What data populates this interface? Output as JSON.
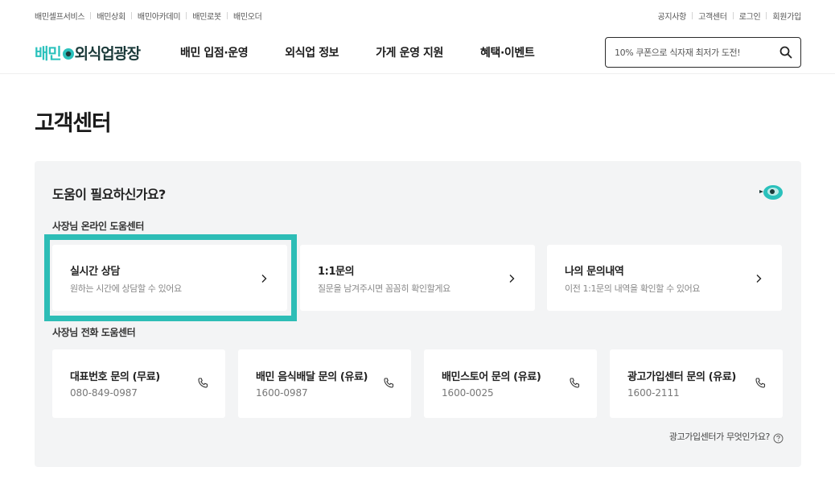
{
  "utility": {
    "left": [
      "배민셀프서비스",
      "배민상회",
      "배민아카데미",
      "배민로봇",
      "배민오더"
    ],
    "right": [
      "공지사항",
      "고객센터",
      "로그인",
      "회원가입"
    ]
  },
  "header": {
    "logo_a": "배민",
    "logo_b": "외식업광장",
    "nav": [
      "배민 입점·운영",
      "외식업 정보",
      "가게 운영 지원",
      "혜택·이벤트"
    ],
    "search_placeholder": "10% 쿠폰으로 식자재 최저가 도전!"
  },
  "page": {
    "title": "고객센터"
  },
  "help": {
    "title": "도움이 필요하신가요?",
    "online_section": "사장님 온라인 도움센터",
    "online_cards": [
      {
        "title": "실시간 상담",
        "desc": "원하는 시간에 상담할 수 있어요"
      },
      {
        "title": "1:1문의",
        "desc": "질문을 남겨주시면 꼼꼼히 확인할게요"
      },
      {
        "title": "나의 문의내역",
        "desc": "이전 1:1문의 내역을 확인할 수 있어요"
      }
    ],
    "phone_section": "사장님 전화 도움센터",
    "phone_cards": [
      {
        "title": "대표번호 문의 (무료)",
        "number": "080-849-0987"
      },
      {
        "title": "배민 음식배달 문의 (유료)",
        "number": "1600-0987"
      },
      {
        "title": "배민스토어 문의 (유료)",
        "number": "1600-0025"
      },
      {
        "title": "광고가입센터 문의 (유료)",
        "number": "1600-2111"
      }
    ],
    "footer_link": "광고가입센터가 무엇인가요?"
  },
  "colors": {
    "brand": "#2ac1bc",
    "highlight": "#2dbdb6",
    "panel_bg": "#f3f4f5"
  },
  "icons": [
    "search-icon",
    "chevron-right-icon",
    "phone-icon",
    "question-circle-icon",
    "mascot-icon",
    "logo-icon"
  ]
}
